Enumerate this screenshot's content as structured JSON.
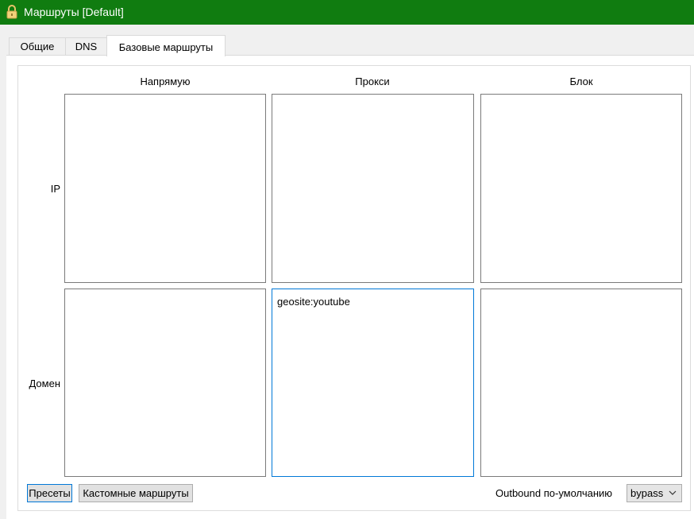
{
  "window": {
    "title": "Маршруты [Default]",
    "titlebar_color": "#107c10"
  },
  "tabs": [
    {
      "label": "Общие"
    },
    {
      "label": "DNS"
    },
    {
      "label": "Базовые маршруты",
      "active": true
    }
  ],
  "columns": [
    "Напрямую",
    "Прокси",
    "Блок"
  ],
  "rows": [
    "IP",
    "Домен"
  ],
  "fields": {
    "ip_direct": "",
    "ip_proxy": "",
    "ip_block": "",
    "domain_direct": "",
    "domain_proxy": "geosite:youtube",
    "domain_block": ""
  },
  "buttons": {
    "preset": "Пресеты",
    "custom_routes": "Кастомные маршруты"
  },
  "outbound": {
    "label": "Outbound по-умолчанию",
    "selected": "bypass"
  },
  "icons": {
    "app": "lock-icon",
    "dropdown": "chevron-down-icon"
  }
}
